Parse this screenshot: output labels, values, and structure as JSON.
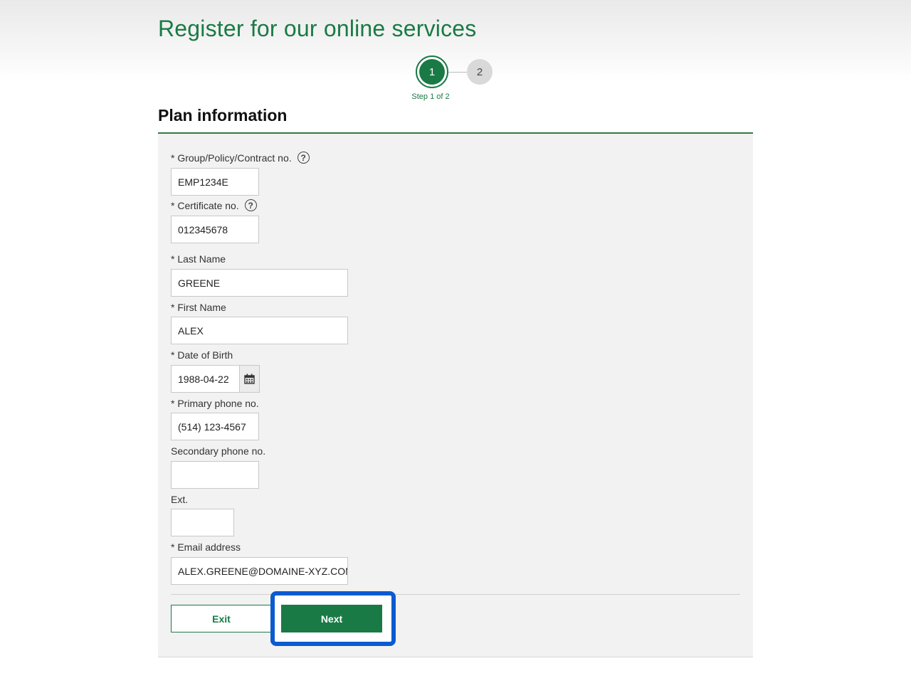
{
  "header": {
    "title": "Register for our online services"
  },
  "stepper": {
    "steps": [
      {
        "number": "1",
        "active": true
      },
      {
        "number": "2",
        "active": false
      }
    ],
    "caption": "Step 1 of 2"
  },
  "section": {
    "title": "Plan information"
  },
  "form": {
    "group_no": {
      "label": "* Group/Policy/Contract no.",
      "value": "EMP1234E"
    },
    "certificate_no": {
      "label": "* Certificate no.",
      "value": "012345678"
    },
    "last_name": {
      "label": "* Last Name",
      "value": "GREENE"
    },
    "first_name": {
      "label": "* First Name",
      "value": "ALEX"
    },
    "date_of_birth": {
      "label": "* Date of Birth",
      "value": "1988-04-22"
    },
    "primary_phone": {
      "label": "* Primary phone no.",
      "value": "(514) 123-4567"
    },
    "secondary_phone": {
      "label": "Secondary phone no.",
      "value": ""
    },
    "ext": {
      "label": "Ext.",
      "value": ""
    },
    "email": {
      "label": "* Email address",
      "value": "ALEX.GREENE@DOMAINE-XYZ.COM"
    },
    "help_glyph": "?"
  },
  "actions": {
    "exit_label": "Exit",
    "next_label": "Next"
  },
  "colors": {
    "brand_green": "#1a7a45",
    "highlight_blue": "#0a5bd0",
    "panel_bg": "#f2f2f2"
  }
}
